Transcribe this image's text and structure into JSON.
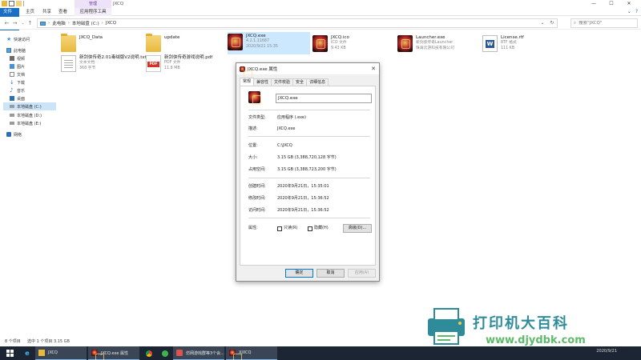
{
  "window": {
    "title": "JXCQ",
    "context_group": "管理",
    "controls": [
      "—",
      "☐",
      "✕"
    ]
  },
  "ribbon": {
    "tabs": [
      "文件",
      "主页",
      "共享",
      "查看",
      "应用程序工具"
    ],
    "right_icons": [
      "chevron-down-icon",
      "help-icon"
    ]
  },
  "nav": {
    "path": [
      "此电脑",
      "本地磁盘 (C:)",
      "JXCQ"
    ],
    "search_placeholder": "搜索\"JXCQ\""
  },
  "sidebar": {
    "items": [
      {
        "label": "快速访问",
        "icon": "star-icon",
        "color": "#4a90d9"
      },
      {
        "label": "此电脑",
        "icon": "computer-icon",
        "color": "#3c7bb0"
      },
      {
        "label": "视频",
        "icon": "video-icon",
        "color": "#6b6b6b"
      },
      {
        "label": "图片",
        "icon": "pictures-icon",
        "color": "#4a8fcf"
      },
      {
        "label": "文档",
        "icon": "documents-icon",
        "color": "#8a8a8a"
      },
      {
        "label": "下载",
        "icon": "download-icon",
        "color": "#2a7bc8"
      },
      {
        "label": "音乐",
        "icon": "music-icon",
        "color": "#3f7fc4"
      },
      {
        "label": "桌面",
        "icon": "desktop-icon",
        "color": "#2f6fb0"
      },
      {
        "label": "本地磁盘 (C:)",
        "icon": "drive-icon",
        "color": "#777777"
      },
      {
        "label": "本地磁盘 (D:)",
        "icon": "drive-icon",
        "color": "#777777"
      },
      {
        "label": "本地磁盘 (E:)",
        "icon": "drive-icon",
        "color": "#777777"
      },
      {
        "label": "网络",
        "icon": "network-icon",
        "color": "#2f6fb0"
      }
    ]
  },
  "files": [
    {
      "name": "JXCQ_Data",
      "sub1": "",
      "sub2": "",
      "icon": "folder-icon"
    },
    {
      "name": "update",
      "sub1": "",
      "sub2": "",
      "icon": "folder-icon"
    },
    {
      "name": "JXCQ.exe",
      "sub1": "4.2.1.11687",
      "sub2": "2020/9/21 15:35",
      "icon": "game-exe-icon"
    },
    {
      "name": "JXCQ.ico",
      "sub1": "ICO 文件",
      "sub2": "9.43 KB",
      "icon": "game-ico-icon"
    },
    {
      "name": "Launcher.exe",
      "sub1": "新剑侠传奇Launcher",
      "sub2": "珠海云游科技有限公司",
      "icon": "launcher-exe-icon"
    },
    {
      "name": "License.rtf",
      "sub1": "RTF 格式",
      "sub2": "111 KB",
      "icon": "rtf-document-icon"
    },
    {
      "name": "新剑侠传奇2.01毒绒版V2说明.txt",
      "sub1": "文本文档",
      "sub2": "368 字节",
      "icon": "text-document-icon"
    },
    {
      "name": "新剑侠传奇游戏说明.pdf",
      "sub1": "PDF 文件",
      "sub2": "11.8 MB",
      "icon": "pdf-document-icon"
    }
  ],
  "status": {
    "count": "8 个项目",
    "selected": "选中 1 个项目  3.15 GB"
  },
  "dialog": {
    "title": "JXCQ.exe 属性",
    "close": "✕",
    "tabs": [
      "常规",
      "兼容性",
      "文件校验",
      "安全",
      "详细信息"
    ],
    "filename": "JXCQ.exe",
    "rows": [
      {
        "label": "文件类型:",
        "value": "应用程序 (.exe)"
      },
      {
        "label": "描述:",
        "value": "JXCQ.exe"
      },
      {
        "label": "位置:",
        "value": "C:\\JXCQ"
      },
      {
        "label": "大小:",
        "value": "3.15 GB (3,388,720,128 字节)"
      },
      {
        "label": "占用空间:",
        "value": "3.15 GB (3,388,723,200 字节)"
      },
      {
        "label": "创建时间:",
        "value": "2020年9月21日，15:35:01"
      },
      {
        "label": "修改时间:",
        "value": "2020年9月21日，15:36:52"
      },
      {
        "label": "访问时间:",
        "value": "2020年9月21日，15:36:52"
      }
    ],
    "attributes_label": "属性:",
    "readonly_label": "只读(R)",
    "hidden_label": "隐藏(H)",
    "advanced_label": "高级(D)...",
    "ok_label": "确定",
    "cancel_label": "取消",
    "apply_label": "应用(A)"
  },
  "watermark": {
    "title": "打印机大百科",
    "url": "www.djydbk.com"
  },
  "taskbar": {
    "items": [
      {
        "label": "",
        "icon": "windows-start-icon"
      },
      {
        "label": "",
        "icon": "ie-browser-icon"
      },
      {
        "label": "JXCQ",
        "icon": "folder-icon"
      },
      {
        "label": "JXCQ.exe 属性",
        "icon": "game-exe-icon"
      },
      {
        "label": "",
        "icon": "chrome-icon"
      },
      {
        "label": "",
        "icon": "green-app-icon"
      },
      {
        "label": "仿网游戏群等3个会...",
        "icon": "chat-icon"
      },
      {
        "label": "XJXCQ",
        "icon": "game-exe-icon"
      }
    ],
    "clock": "2020/9/21"
  },
  "colors": {
    "accent": "#1a6fc4",
    "selection": "#cce8ff",
    "taskbar": "#1b2533"
  }
}
